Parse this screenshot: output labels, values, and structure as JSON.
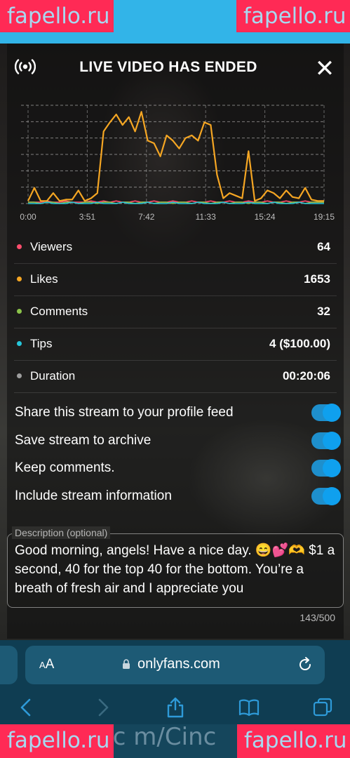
{
  "watermarks": {
    "top_left": "fapello.ru",
    "top_right": "fapello.ru",
    "bottom_left": "fapello.ru",
    "bottom_right": "fapello.ru"
  },
  "modal": {
    "title": "LIVE VIDEO HAS ENDED",
    "close_icon": "close-icon",
    "live_icon": "broadcast-icon"
  },
  "chart_data": {
    "type": "line",
    "x_ticks": [
      "0:00",
      "3:51",
      "7:42",
      "11:33",
      "15:24",
      "19:15"
    ],
    "grid": true,
    "series": [
      {
        "name": "Likes",
        "color": "#f5a623",
        "values": [
          2,
          12,
          2,
          2,
          8,
          2,
          3,
          3,
          10,
          2,
          4,
          8,
          55,
          62,
          68,
          60,
          66,
          55,
          70,
          48,
          46,
          36,
          52,
          48,
          42,
          50,
          52,
          48,
          62,
          60,
          22,
          4,
          8,
          6,
          4,
          40,
          2,
          4,
          10,
          8,
          4,
          10,
          5,
          4,
          12,
          3,
          2,
          2
        ]
      },
      {
        "name": "Viewers",
        "color": "#ff4d6d",
        "values": [
          1,
          1,
          1,
          2,
          1,
          1,
          2,
          1,
          1,
          1,
          2,
          1,
          2,
          1,
          2,
          1,
          1,
          2,
          1,
          1,
          2,
          1,
          1,
          2,
          1,
          1,
          2,
          1,
          1,
          2,
          1,
          1,
          2,
          1,
          1,
          2,
          1,
          1,
          2,
          1,
          1,
          2,
          1,
          1,
          2,
          1,
          1,
          1
        ]
      },
      {
        "name": "Comments",
        "color": "#8bc34a",
        "values": [
          1,
          1,
          0,
          1,
          1,
          0,
          1,
          1,
          0,
          1,
          1,
          0,
          1,
          1,
          0,
          1,
          1,
          0,
          1,
          1,
          0,
          1,
          1,
          0,
          1,
          1,
          0,
          1,
          1,
          0,
          1,
          1,
          0,
          1,
          1,
          0,
          1,
          1,
          0,
          1,
          1,
          0,
          1,
          1,
          0,
          1,
          1,
          1
        ]
      },
      {
        "name": "Tips",
        "color": "#26c6da",
        "values": [
          0,
          0,
          0,
          1,
          0,
          0,
          0,
          1,
          0,
          0,
          0,
          1,
          0,
          0,
          0,
          1,
          0,
          0,
          0,
          1,
          0,
          0,
          0,
          1,
          0,
          0,
          0,
          1,
          0,
          0,
          0,
          1,
          0,
          0,
          0,
          1,
          0,
          0,
          0,
          1,
          0,
          0,
          0,
          1,
          0,
          0,
          0,
          0
        ]
      }
    ],
    "ylim": [
      0,
      75
    ]
  },
  "stats": [
    {
      "label": "Viewers",
      "value": "64",
      "color": "#ff4d6d"
    },
    {
      "label": "Likes",
      "value": "1653",
      "color": "#f5a623"
    },
    {
      "label": "Comments",
      "value": "32",
      "color": "#8bc34a"
    },
    {
      "label": "Tips",
      "value": "4 ($100.00)",
      "color": "#26c6da"
    },
    {
      "label": "Duration",
      "value": "00:20:06",
      "color": "#9e9e9e"
    }
  ],
  "toggles": [
    {
      "label": "Share this stream to your profile feed",
      "on": true
    },
    {
      "label": "Save stream to archive",
      "on": true
    },
    {
      "label": "Keep comments.",
      "on": true
    },
    {
      "label": "Include stream information",
      "on": true
    }
  ],
  "description": {
    "label": "Description (optional)",
    "text": "Good morning, angels!  Have a nice day. 😄💕🫶 $1 a second, 40 for the top 40 for the bottom. You’re a breath of fresh air and I appreciate you",
    "counter": "143/500"
  },
  "browser": {
    "aa_label_small": "A",
    "aa_label_big": "A",
    "url": "onlyfans.com",
    "nav": [
      "back-icon",
      "forward-icon",
      "share-icon",
      "bookmarks-icon",
      "tabs-icon"
    ]
  },
  "bottom_text": ".c m/Cinc"
}
